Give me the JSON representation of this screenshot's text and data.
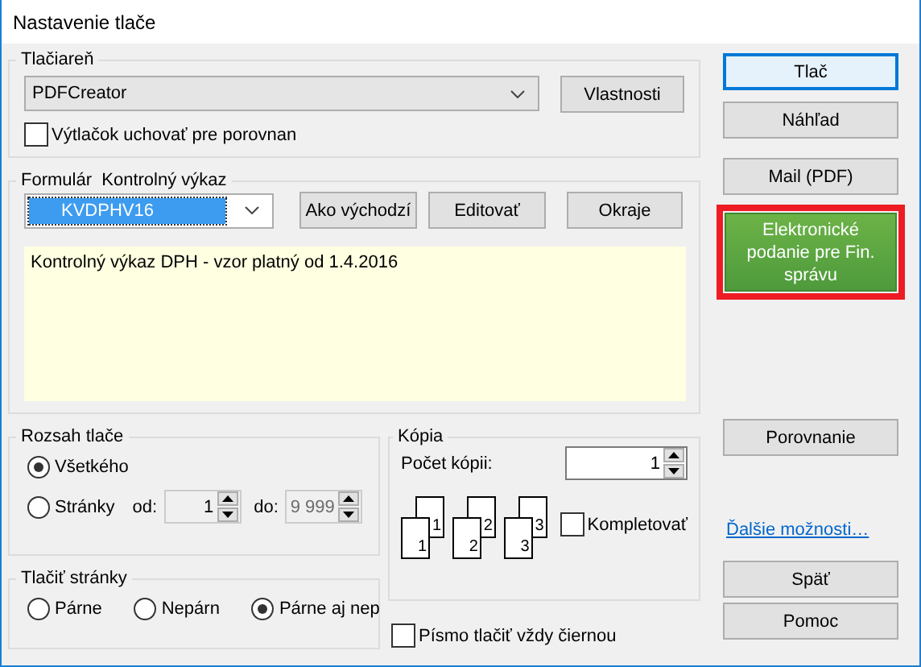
{
  "window": {
    "title": "Nastavenie tlače"
  },
  "printer": {
    "label": "Tlačiareň",
    "value": "PDFCreator",
    "properties_button": "Vlastnosti",
    "keep_copy": {
      "label": "Výtlačok uchovať pre porovnan",
      "checked": false
    }
  },
  "form": {
    "label": "Formulár",
    "name": "Kontrolný výkaz",
    "value": "KVDPHV16",
    "buttons": [
      "Ako východzí",
      "Editovať",
      "Okraje"
    ],
    "description": "Kontrolný výkaz DPH - vzor platný od 1.4.2016"
  },
  "range": {
    "label": "Rozsah tlače",
    "options": [
      {
        "label": "Všetkého",
        "selected": true
      },
      {
        "label": "Stránky",
        "selected": false
      }
    ],
    "from_label": "od:",
    "from": "1",
    "to_label": "do:",
    "to": "9 999"
  },
  "pages": {
    "label": "Tlačiť stránky",
    "options": [
      {
        "label": "Párne",
        "selected": false
      },
      {
        "label": "Nepárn",
        "selected": false
      },
      {
        "label": "Párne aj nep",
        "selected": true
      }
    ]
  },
  "copies": {
    "label": "Kópia",
    "count_label": "Počet kópii:",
    "count": "1",
    "collate": {
      "label": "Kompletovať",
      "checked": false
    },
    "stacks": [
      {
        "back": "1",
        "front": "1"
      },
      {
        "back": "2",
        "front": "2"
      },
      {
        "back": "3",
        "front": "3"
      }
    ]
  },
  "black_text": {
    "label": "Písmo tlačiť vždy čiernou",
    "checked": false
  },
  "actions": [
    {
      "kind": "button",
      "label": "Tlač",
      "focused": true
    },
    {
      "kind": "button",
      "label": "Náhľad",
      "focused": false
    },
    {
      "kind": "button",
      "label": "Mail (PDF)",
      "focused": false
    },
    {
      "kind": "highlight",
      "label": "Elektronické podanie pre Fin. správu"
    },
    {
      "kind": "button",
      "label": "Porovnanie",
      "focused": false
    },
    {
      "kind": "link",
      "label": "Ďalšie možnosti…"
    },
    {
      "kind": "button",
      "label": "Späť",
      "focused": false
    },
    {
      "kind": "button",
      "label": "Pomoc",
      "focused": false
    }
  ]
}
